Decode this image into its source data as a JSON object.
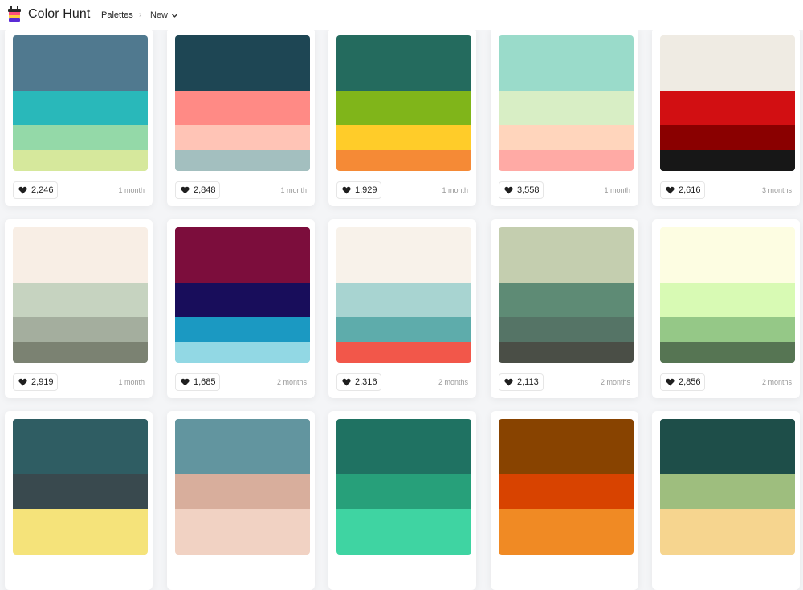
{
  "app": {
    "brand": "Color Hunt",
    "nav_palettes": "Palettes",
    "nav_separator": "›",
    "nav_new": "New"
  },
  "palettes": [
    {
      "likes": "2,246",
      "age": "1 month",
      "colors": [
        "#50798f",
        "#29b8ba",
        "#94d9a8",
        "#d6e89c"
      ]
    },
    {
      "likes": "2,848",
      "age": "1 month",
      "colors": [
        "#1e4654",
        "#ff8a85",
        "#ffc4b6",
        "#a3bfbf"
      ]
    },
    {
      "likes": "1,929",
      "age": "1 month",
      "colors": [
        "#246b5e",
        "#80b51a",
        "#ffcc29",
        "#f58a36"
      ]
    },
    {
      "likes": "3,558",
      "age": "1 month",
      "colors": [
        "#9adbca",
        "#d8eec5",
        "#ffd5bc",
        "#ffaaa5"
      ]
    },
    {
      "likes": "2,616",
      "age": "3 months",
      "colors": [
        "#efebe3",
        "#d20f12",
        "#8a0000",
        "#171717"
      ]
    },
    {
      "likes": "2,919",
      "age": "1 month",
      "colors": [
        "#f8eee5",
        "#c6d3c0",
        "#a4ae9e",
        "#7b8272"
      ]
    },
    {
      "likes": "1,685",
      "age": "2 months",
      "colors": [
        "#7c0d3c",
        "#180d5b",
        "#1b99c2",
        "#92d8e4"
      ]
    },
    {
      "likes": "2,316",
      "age": "2 months",
      "colors": [
        "#f8f2ea",
        "#a8d4d1",
        "#5eacab",
        "#f2574a"
      ]
    },
    {
      "likes": "2,113",
      "age": "2 months",
      "colors": [
        "#c4ceaf",
        "#5e8b75",
        "#557466",
        "#4a4e46"
      ]
    },
    {
      "likes": "2,856",
      "age": "2 months",
      "colors": [
        "#fdfde2",
        "#d8fab4",
        "#95c887",
        "#567553"
      ]
    },
    {
      "likes": "",
      "age": "",
      "colors": [
        "#2f5d63",
        "#39494e",
        "#f5e37a",
        "#f5e37a"
      ]
    },
    {
      "likes": "",
      "age": "",
      "colors": [
        "#62959f",
        "#d8ae9c",
        "#f1d2c3",
        "#f1d2c3"
      ]
    },
    {
      "likes": "",
      "age": "",
      "colors": [
        "#1f7262",
        "#27a07a",
        "#3fd4a2",
        "#3fd4a2"
      ]
    },
    {
      "likes": "",
      "age": "",
      "colors": [
        "#884300",
        "#d84300",
        "#f08a24",
        "#f08a24"
      ]
    },
    {
      "likes": "",
      "age": "",
      "colors": [
        "#1e4e49",
        "#9ebe7e",
        "#f6d58f",
        "#f6d58f"
      ]
    }
  ]
}
